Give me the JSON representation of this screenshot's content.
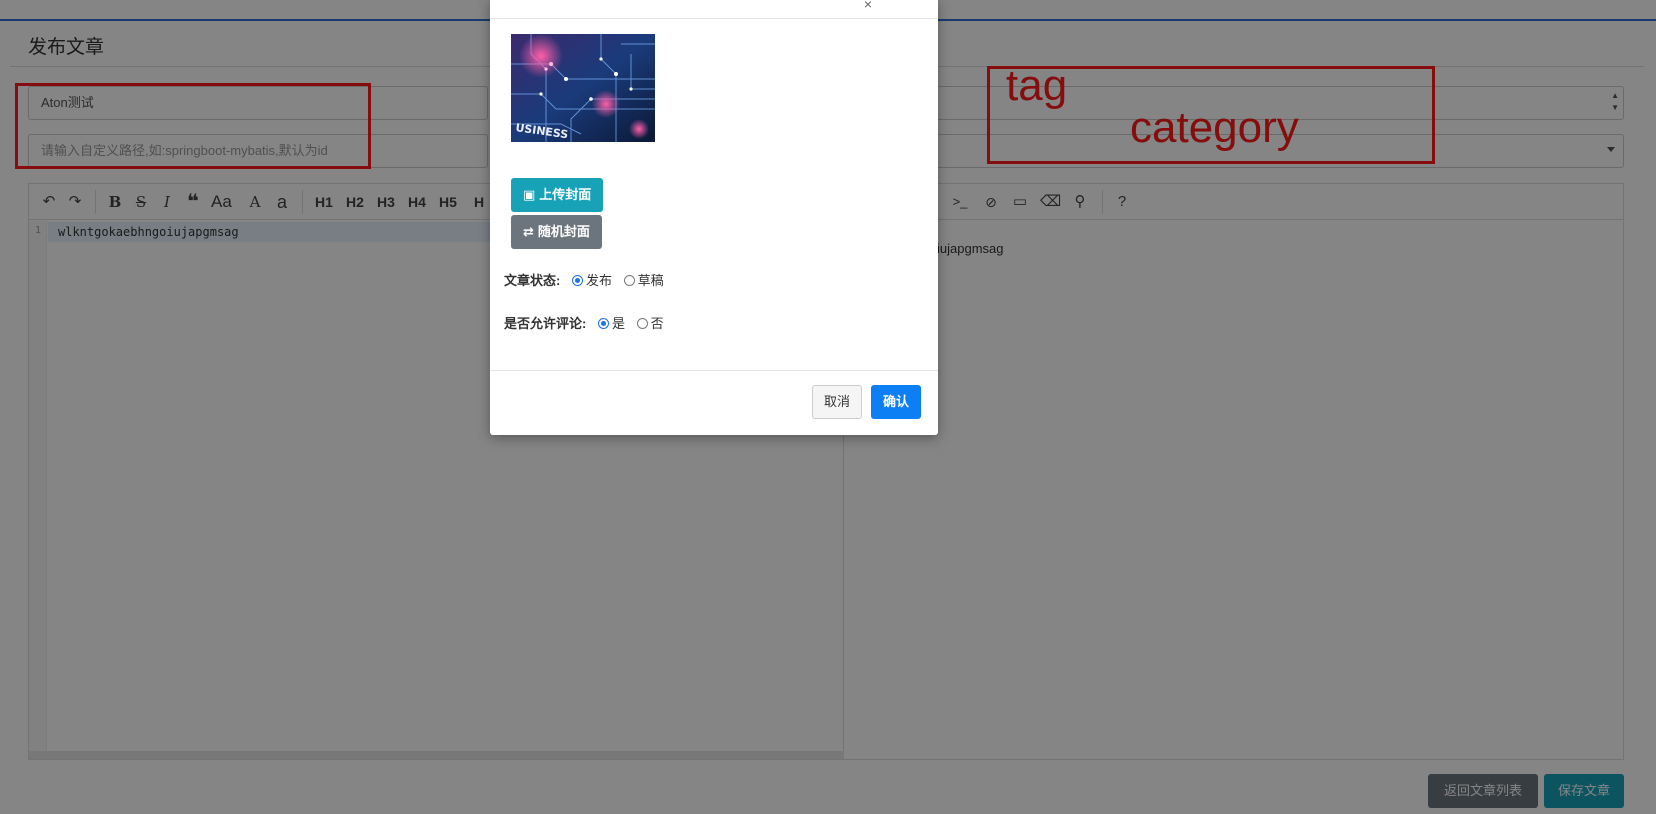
{
  "page": {
    "title": "发布文章"
  },
  "form": {
    "title_value": "Aton测试",
    "path_placeholder": "请输入自定义路径,如:springboot-mybatis,默认为id"
  },
  "annotations": {
    "tag": "tag",
    "category": "category"
  },
  "editor": {
    "toolbar": {
      "text_buttons": [
        "B",
        "S",
        "I",
        "Aa",
        "A",
        "a"
      ],
      "headings": [
        "H1",
        "H2",
        "H3",
        "H4",
        "H5",
        "H"
      ],
      "right_tools": [
        ">_"
      ],
      "icons": [
        "undo-icon",
        "redo-icon",
        "quote-icon",
        "eye-slash-icon",
        "desktop-icon",
        "eraser-icon",
        "search-icon",
        "help-icon"
      ]
    },
    "line_number": "1",
    "content": "wlkntgokaebhngoiujapgmsag",
    "preview_fragment": "iujapgmsag"
  },
  "footer_buttons": {
    "back": "返回文章列表",
    "save": "保存文章"
  },
  "modal": {
    "upload_label": "上传封面",
    "random_label": "随机封面",
    "status": {
      "label": "文章状态:",
      "options": [
        "发布",
        "草稿"
      ],
      "selected": "发布"
    },
    "comments": {
      "label": "是否允许评论:",
      "options": [
        "是",
        "否"
      ],
      "selected": "是"
    },
    "cancel_label": "取消",
    "ok_label": "确认"
  },
  "colors": {
    "accent_blue": "#0d7ff5",
    "info": "#17a2b8",
    "secondary": "#6c757d",
    "annotation_red": "#ff1a1a"
  }
}
